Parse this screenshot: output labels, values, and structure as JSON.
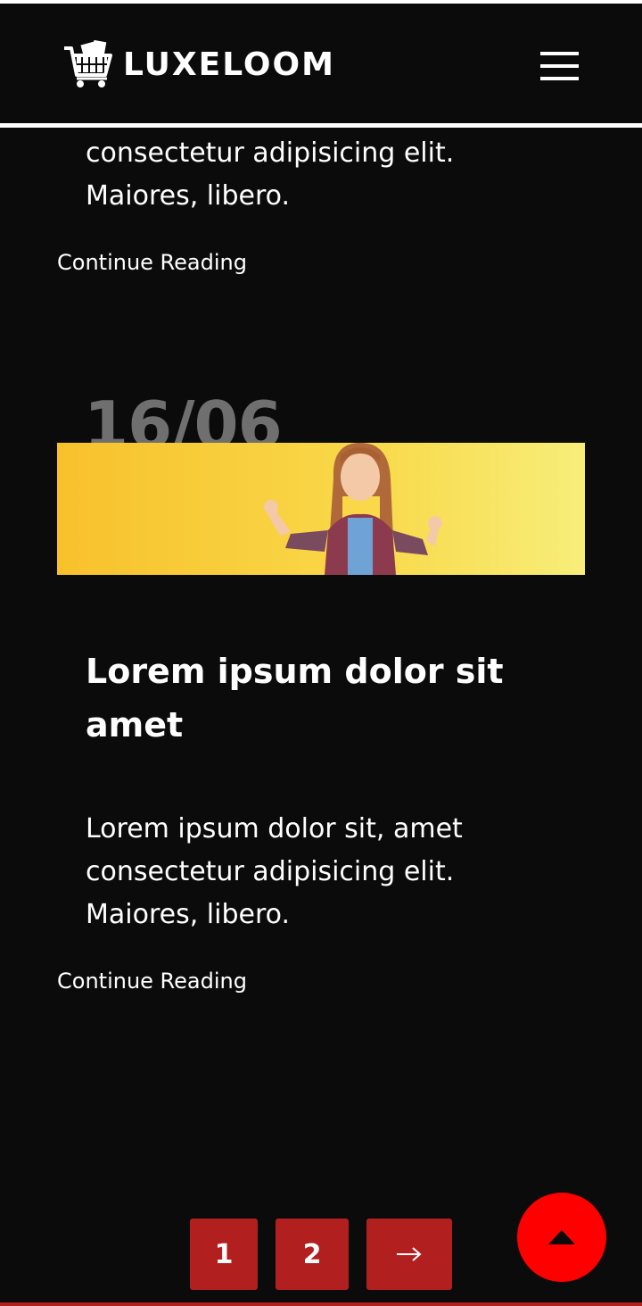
{
  "header": {
    "brand": "LUXELOOM",
    "logo_icon": "shopping-cart-icon",
    "menu_icon": "hamburger-menu-icon"
  },
  "posts": [
    {
      "excerpt_lines": [
        "consectetur adipisicing elit.",
        "Maiores, libero."
      ],
      "continue_label": "Continue Reading"
    },
    {
      "date": "16/06",
      "image": "girl-yellow-background-photo",
      "title_lines": [
        "Lorem ipsum dolor sit",
        "amet"
      ],
      "excerpt_lines": [
        "Lorem ipsum dolor sit, amet",
        "consectetur adipisicing elit.",
        "Maiores, libero."
      ],
      "continue_label": "Continue Reading"
    }
  ],
  "pagination": {
    "pages": [
      "1",
      "2"
    ],
    "next_icon": "arrow-right-icon"
  },
  "back_to_top_icon": "triangle-up-icon",
  "colors": {
    "background": "#0b0b0b",
    "accent_red": "#b21f1f",
    "to_top_red": "#ff0000"
  }
}
